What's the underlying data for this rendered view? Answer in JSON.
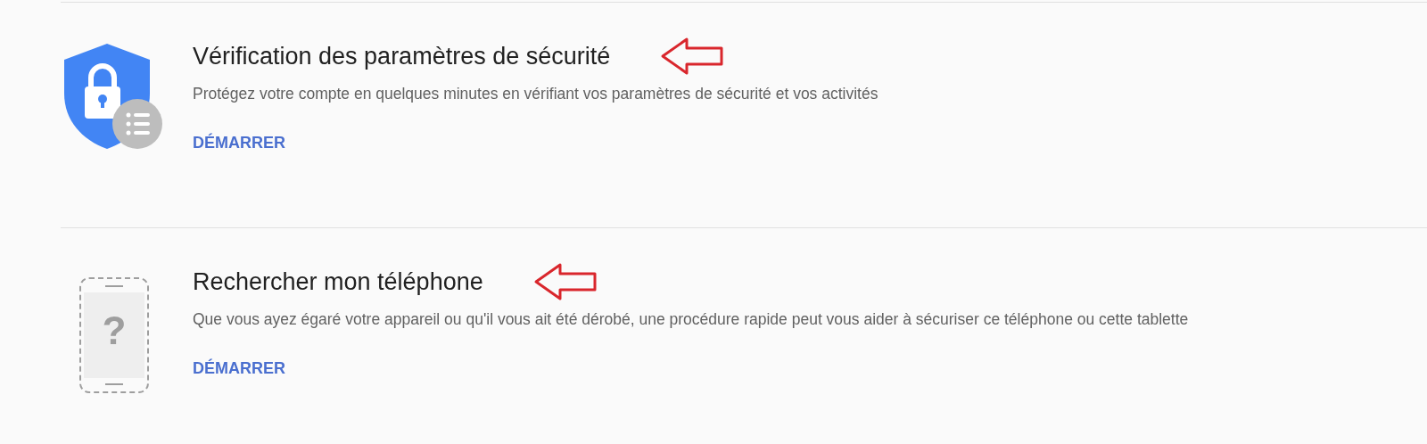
{
  "cards": [
    {
      "kind": "security",
      "title": "Vérification des paramètres de sécurité",
      "description": "Protégez votre compte en quelques minutes en vérifiant vos paramètres de sécurité et vos activités",
      "action": "DÉMARRER",
      "annotation_arrow": true
    },
    {
      "kind": "phone",
      "icon_glyph": "?",
      "title": "Rechercher mon téléphone",
      "description": "Que vous ayez égaré votre appareil ou qu'il vous ait été dérobé, une procédure rapide peut vous aider à sécuriser ce téléphone ou cette tablette",
      "action": "DÉMARRER",
      "annotation_arrow": true
    }
  ]
}
